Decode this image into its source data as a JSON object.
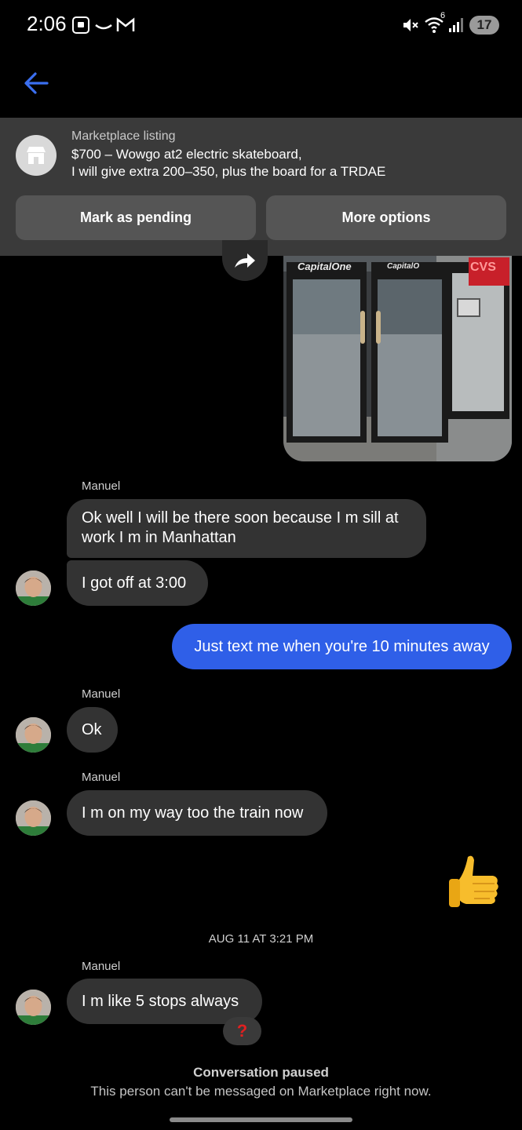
{
  "status_bar": {
    "time": "2:06",
    "battery": "17",
    "signal_tag": "6"
  },
  "header": {
    "back_icon": "arrow-left-icon"
  },
  "listing": {
    "label": "Marketplace listing",
    "title_line1": "$700 – Wowgo at2 electric skateboard,",
    "title_line2": "I will give extra 200–350, plus the board for a  TRDAE",
    "mark_pending_label": "Mark as pending",
    "more_options_label": "More options"
  },
  "photo": {
    "sign_left": "CapitalOne",
    "sign_right": "CapitalO",
    "sign_corner": "CVS"
  },
  "messages": [
    {
      "sender": "Manuel",
      "text": "Ok well I will be there soon because I m sill at work I m in Manhattan"
    },
    {
      "text": "I got off at 3:00"
    },
    {
      "direction": "outgoing",
      "text": "Just text me when you're 10 minutes away"
    },
    {
      "sender": "Manuel",
      "text": "Ok"
    },
    {
      "sender": "Manuel",
      "text": "I m on my way too the train now"
    },
    {
      "direction": "outgoing",
      "type": "emoji",
      "emoji": "thumbs-up"
    },
    {
      "sender": "Manuel",
      "text": "I m like 5 stops always",
      "reaction": "?"
    }
  ],
  "timestamp": "AUG 11 AT 3:21 PM",
  "footer": {
    "paused_title": "Conversation paused",
    "paused_subtitle": "This person can't be messaged on Marketplace right now."
  },
  "colors": {
    "outgoing_bubble": "#2f5fe8",
    "incoming_bubble": "#333333",
    "panel": "#3a3a3a",
    "accent_back": "#3b6ff0"
  }
}
